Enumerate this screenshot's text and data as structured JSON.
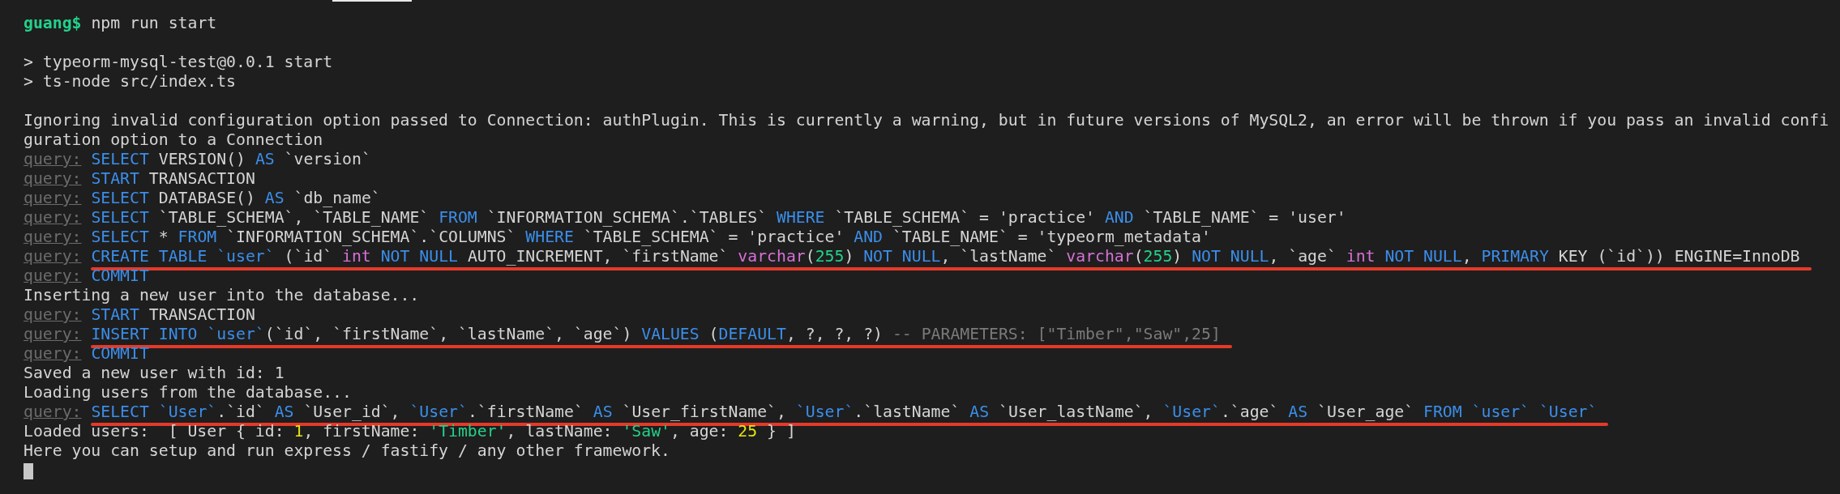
{
  "lines": [
    {
      "kind": "prompt",
      "segments": [
        {
          "text": "guang$",
          "kind": "prompt"
        },
        {
          "text": " npm run start",
          "kind": "plain"
        }
      ],
      "underlined": false
    },
    {
      "kind": "blank"
    },
    {
      "kind": "output",
      "segments": [
        {
          "text": "> typeorm-mysql-test@0.0.1 start",
          "kind": "plain"
        }
      ],
      "underlined": false
    },
    {
      "kind": "output",
      "segments": [
        {
          "text": "> ts-node src/index.ts",
          "kind": "plain"
        }
      ],
      "underlined": false
    },
    {
      "kind": "blank"
    },
    {
      "kind": "output",
      "segments": [
        {
          "text": "Ignoring invalid configuration option passed to Connection: authPlugin. This is currently a warning, but in future versions of MySQL2, an error will be thrown if you pass an invalid confi",
          "kind": "plain"
        }
      ],
      "underlined": false
    },
    {
      "kind": "output",
      "segments": [
        {
          "text": "guration option to a Connection",
          "kind": "plain"
        }
      ],
      "underlined": false
    },
    {
      "kind": "query",
      "label": "query:",
      "segments": [
        {
          "text": "SELECT",
          "kind": "kw"
        },
        {
          "text": " VERSION() ",
          "kind": "plain"
        },
        {
          "text": "AS",
          "kind": "kw"
        },
        {
          "text": " `version`",
          "kind": "plain"
        }
      ],
      "underlined": false
    },
    {
      "kind": "query",
      "label": "query:",
      "segments": [
        {
          "text": "START",
          "kind": "kw"
        },
        {
          "text": " TRANSACTION",
          "kind": "plain"
        }
      ],
      "underlined": false
    },
    {
      "kind": "query",
      "label": "query:",
      "segments": [
        {
          "text": "SELECT",
          "kind": "kw"
        },
        {
          "text": " DATABASE() ",
          "kind": "plain"
        },
        {
          "text": "AS",
          "kind": "kw"
        },
        {
          "text": " `db_name`",
          "kind": "plain"
        }
      ],
      "underlined": false
    },
    {
      "kind": "query",
      "label": "query:",
      "segments": [
        {
          "text": "SELECT",
          "kind": "kw"
        },
        {
          "text": " `TABLE_SCHEMA`, `TABLE_NAME` ",
          "kind": "plain"
        },
        {
          "text": "FROM",
          "kind": "kw"
        },
        {
          "text": " `INFORMATION_SCHEMA`.`TABLES` ",
          "kind": "plain"
        },
        {
          "text": "WHERE",
          "kind": "kw"
        },
        {
          "text": " `TABLE_SCHEMA` = 'practice' ",
          "kind": "plain"
        },
        {
          "text": "AND",
          "kind": "kw"
        },
        {
          "text": " `TABLE_NAME` = 'user'",
          "kind": "plain"
        }
      ],
      "underlined": false
    },
    {
      "kind": "query",
      "label": "query:",
      "segments": [
        {
          "text": "SELECT",
          "kind": "kw"
        },
        {
          "text": " * ",
          "kind": "plain"
        },
        {
          "text": "FROM",
          "kind": "kw"
        },
        {
          "text": " `INFORMATION_SCHEMA`.`COLUMNS` ",
          "kind": "plain"
        },
        {
          "text": "WHERE",
          "kind": "kw"
        },
        {
          "text": " `TABLE_SCHEMA` = 'practice' ",
          "kind": "plain"
        },
        {
          "text": "AND",
          "kind": "kw"
        },
        {
          "text": " `TABLE_NAME` = 'typeorm_metadata'",
          "kind": "plain"
        }
      ],
      "underlined": false
    },
    {
      "kind": "query",
      "label": "query:",
      "segments": [
        {
          "text": "CREATE TABLE `user`",
          "kind": "kw"
        },
        {
          "text": " (`id` ",
          "kind": "plain"
        },
        {
          "text": "int",
          "kind": "type"
        },
        {
          "text": " NOT NULL",
          "kind": "kw"
        },
        {
          "text": " AUTO_INCREMENT, `firstName` ",
          "kind": "plain"
        },
        {
          "text": "varchar",
          "kind": "type"
        },
        {
          "text": "(",
          "kind": "plain"
        },
        {
          "text": "255",
          "kind": "num"
        },
        {
          "text": ") ",
          "kind": "plain"
        },
        {
          "text": "NOT NULL",
          "kind": "kw"
        },
        {
          "text": ", `lastName` ",
          "kind": "plain"
        },
        {
          "text": "varchar",
          "kind": "type"
        },
        {
          "text": "(",
          "kind": "plain"
        },
        {
          "text": "255",
          "kind": "num"
        },
        {
          "text": ") ",
          "kind": "plain"
        },
        {
          "text": "NOT NULL",
          "kind": "kw"
        },
        {
          "text": ", `age` ",
          "kind": "plain"
        },
        {
          "text": "int",
          "kind": "type"
        },
        {
          "text": " NOT NULL",
          "kind": "kw"
        },
        {
          "text": ", ",
          "kind": "plain"
        },
        {
          "text": "PRIMARY",
          "kind": "kw"
        },
        {
          "text": " KEY (`id`)) ENGINE=InnoDB",
          "kind": "plain"
        }
      ],
      "underlined": true
    },
    {
      "kind": "query",
      "label": "query:",
      "segments": [
        {
          "text": "COMMIT",
          "kind": "kw"
        }
      ],
      "underlined": false
    },
    {
      "kind": "output",
      "segments": [
        {
          "text": "Inserting a new user into the database...",
          "kind": "plain"
        }
      ],
      "underlined": false
    },
    {
      "kind": "query",
      "label": "query:",
      "segments": [
        {
          "text": "START",
          "kind": "kw"
        },
        {
          "text": " TRANSACTION",
          "kind": "plain"
        }
      ],
      "underlined": false
    },
    {
      "kind": "query",
      "label": "query:",
      "segments": [
        {
          "text": "INSERT INTO `user`",
          "kind": "kw"
        },
        {
          "text": "(`id`, `firstName`, `lastName`, `age`) ",
          "kind": "plain"
        },
        {
          "text": "VALUES",
          "kind": "kw"
        },
        {
          "text": " (",
          "kind": "plain"
        },
        {
          "text": "DEFAULT",
          "kind": "kw"
        },
        {
          "text": ", ?, ?, ?) ",
          "kind": "plain"
        },
        {
          "text": "-- PARAMETERS: [\"Timber\",\"Saw\",25]",
          "kind": "comment"
        }
      ],
      "underlined": true
    },
    {
      "kind": "query",
      "label": "query:",
      "segments": [
        {
          "text": "COMMIT",
          "kind": "kw"
        }
      ],
      "underlined": false
    },
    {
      "kind": "output",
      "segments": [
        {
          "text": "Saved a new user with id: 1",
          "kind": "plain"
        }
      ],
      "underlined": false
    },
    {
      "kind": "output",
      "segments": [
        {
          "text": "Loading users from the database...",
          "kind": "plain"
        }
      ],
      "underlined": false
    },
    {
      "kind": "query",
      "label": "query:",
      "segments": [
        {
          "text": "SELECT `User`",
          "kind": "kw"
        },
        {
          "text": ".`id` ",
          "kind": "plain"
        },
        {
          "text": "AS",
          "kind": "kw"
        },
        {
          "text": " `User_id`, ",
          "kind": "plain"
        },
        {
          "text": "`User`",
          "kind": "kw"
        },
        {
          "text": ".`firstName` ",
          "kind": "plain"
        },
        {
          "text": "AS",
          "kind": "kw"
        },
        {
          "text": " `User_firstName`, ",
          "kind": "plain"
        },
        {
          "text": "`User`",
          "kind": "kw"
        },
        {
          "text": ".`lastName` ",
          "kind": "plain"
        },
        {
          "text": "AS",
          "kind": "kw"
        },
        {
          "text": " `User_lastName`, ",
          "kind": "plain"
        },
        {
          "text": "`User`",
          "kind": "kw"
        },
        {
          "text": ".`age` ",
          "kind": "plain"
        },
        {
          "text": "AS",
          "kind": "kw"
        },
        {
          "text": " `User_age` ",
          "kind": "plain"
        },
        {
          "text": "FROM `user` `User`",
          "kind": "kw"
        }
      ],
      "underlined": true
    },
    {
      "kind": "output",
      "segments": [
        {
          "text": "Loaded users:  [ User { id: ",
          "kind": "plain"
        },
        {
          "text": "1",
          "kind": "yellow"
        },
        {
          "text": ", firstName: ",
          "kind": "plain"
        },
        {
          "text": "'Timber'",
          "kind": "str"
        },
        {
          "text": ", lastName: ",
          "kind": "plain"
        },
        {
          "text": "'Saw'",
          "kind": "str"
        },
        {
          "text": ", age: ",
          "kind": "plain"
        },
        {
          "text": "25",
          "kind": "yellow"
        },
        {
          "text": " } ]",
          "kind": "plain"
        }
      ],
      "underlined": false
    },
    {
      "kind": "output",
      "segments": [
        {
          "text": "Here you can setup and run express / fastify / any other framework.",
          "kind": "plain"
        }
      ],
      "underlined": false
    },
    {
      "kind": "cursor"
    }
  ]
}
